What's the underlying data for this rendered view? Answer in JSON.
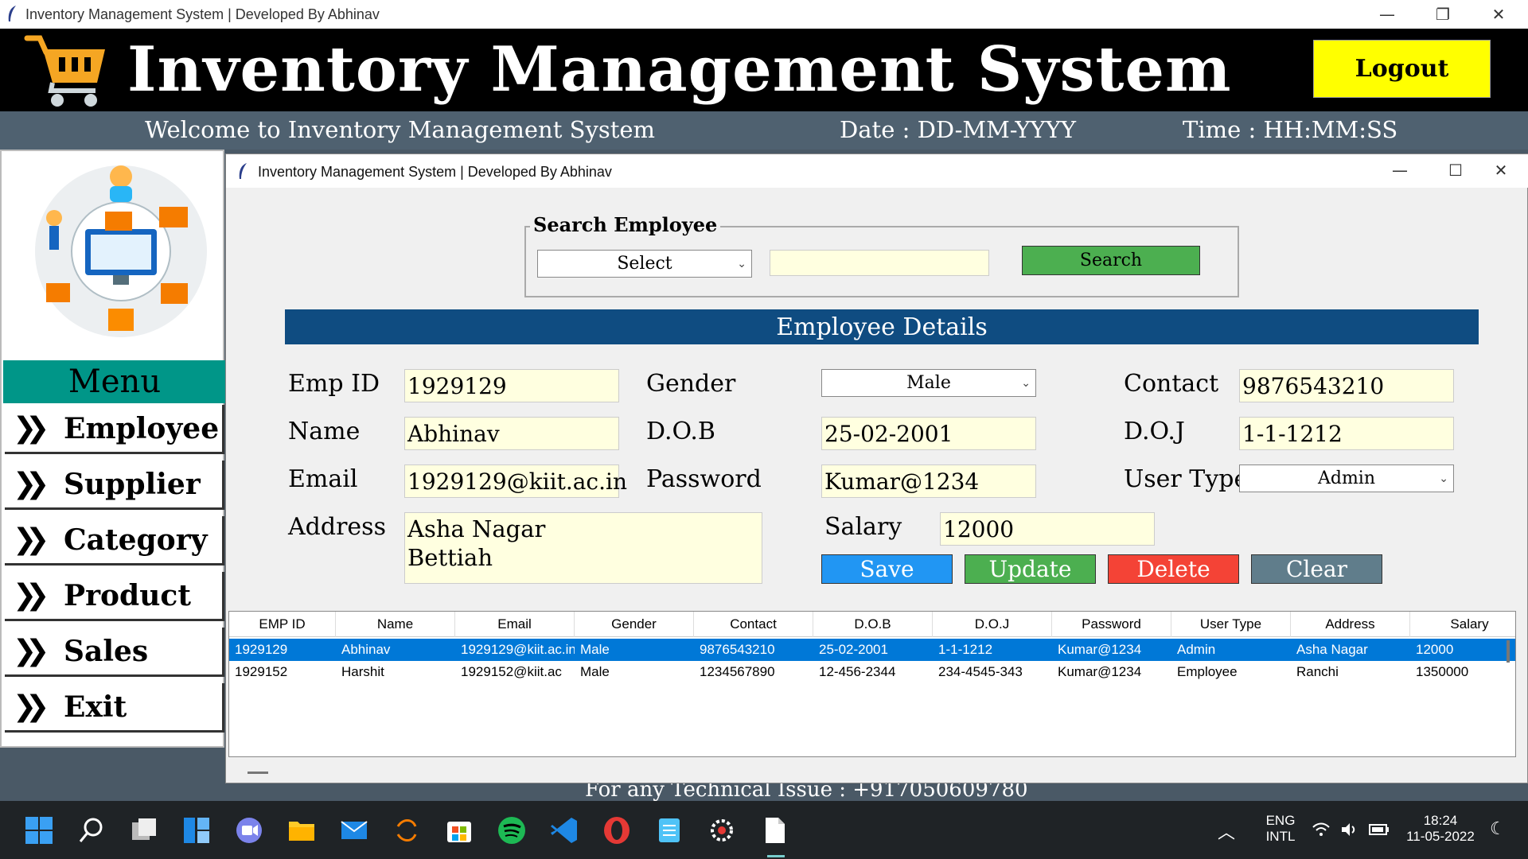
{
  "window": {
    "title": "Inventory Management System | Developed By Abhinav"
  },
  "header": {
    "title": "Inventory Management System",
    "logout_label": "Logout"
  },
  "subheader": {
    "welcome": "Welcome to Inventory Management System",
    "date": "Date : DD-MM-YYYY",
    "time": "Time : HH:MM:SS"
  },
  "menu": {
    "title": "Menu",
    "items": [
      {
        "label": "Employee"
      },
      {
        "label": "Supplier"
      },
      {
        "label": "Category"
      },
      {
        "label": "Product"
      },
      {
        "label": "Sales"
      },
      {
        "label": "Exit"
      }
    ]
  },
  "footer": {
    "text": "For any Technical Issue : +917050609780"
  },
  "inner_window": {
    "title": "Inventory Management System | Developed By Abhinav"
  },
  "search": {
    "legend": "Search Employee",
    "select_value": "Select",
    "query": "",
    "button_label": "Search"
  },
  "details": {
    "heading": "Employee Details",
    "labels": {
      "emp_id": "Emp ID",
      "gender": "Gender",
      "contact": "Contact",
      "name": "Name",
      "dob": "D.O.B",
      "doj": "D.O.J",
      "email": "Email",
      "password": "Password",
      "user_type": "User Type",
      "address": "Address",
      "salary": "Salary"
    },
    "values": {
      "emp_id": "1929129",
      "gender": "Male",
      "contact": "9876543210",
      "name": "Abhinav",
      "dob": "25-02-2001",
      "doj": "1-1-1212",
      "email": "1929129@kiit.ac.in",
      "password": "Kumar@1234",
      "user_type": "Admin",
      "address_line1": "Asha Nagar",
      "address_line2": "Bettiah",
      "salary": "12000"
    },
    "buttons": {
      "save": "Save",
      "update": "Update",
      "delete": "Delete",
      "clear": "Clear"
    },
    "button_colors": {
      "save": "#2196f3",
      "update": "#4caf50",
      "delete": "#f44336",
      "clear": "#607d8b"
    }
  },
  "table": {
    "columns": [
      "EMP ID",
      "Name",
      "Email",
      "Gender",
      "Contact",
      "D.O.B",
      "D.O.J",
      "Password",
      "User Type",
      "Address",
      "Salary"
    ],
    "rows": [
      [
        "1929129",
        "Abhinav",
        "1929129@kiit.ac.in",
        "Male",
        "9876543210",
        "25-02-2001",
        "1-1-1212",
        "Kumar@1234",
        "Admin",
        "Asha Nagar",
        "12000"
      ],
      [
        "1929152",
        "Harshit",
        "1929152@kiit.ac",
        "Male",
        "1234567890",
        "12-456-2344",
        "234-4545-343",
        "Kumar@1234",
        "Employee",
        "Ranchi",
        "1350000"
      ]
    ],
    "selected_row": 0
  },
  "taskbar": {
    "lang_line1": "ENG",
    "lang_line2": "INTL",
    "time": "18:24",
    "date": "11-05-2022",
    "icons": [
      "windows-start-icon",
      "search-icon",
      "task-view-icon",
      "widgets-icon",
      "teams-chat-icon",
      "file-explorer-icon",
      "mail-icon",
      "app-icon",
      "microsoft-store-icon",
      "spotify-icon",
      "vscode-icon",
      "opera-icon",
      "notepad-icon",
      "settings-gear-icon",
      "document-icon"
    ]
  },
  "colors": {
    "header_bg": "#000000",
    "logout_bg": "#ffff00",
    "menu_title_bg": "#009688",
    "details_bar": "#0f4c81",
    "entry_bg": "#ffffe0",
    "selected_row": "#0078d7"
  }
}
